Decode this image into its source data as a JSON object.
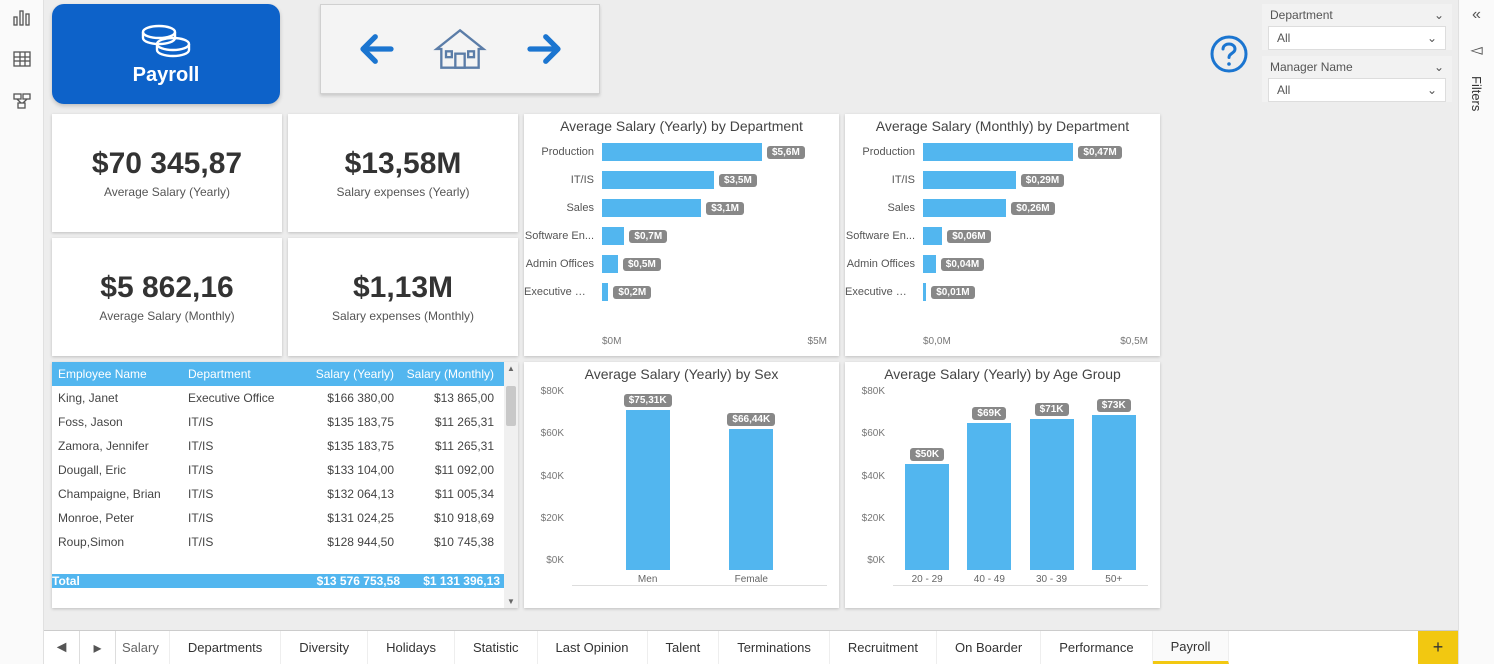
{
  "header": {
    "tile_label": "Payroll"
  },
  "slicers": {
    "department": {
      "label": "Department",
      "value": "All"
    },
    "manager": {
      "label": "Manager Name",
      "value": "All"
    }
  },
  "filters_panel_label": "Filters",
  "kpis": [
    {
      "value": "$70 345,87",
      "label": "Average Salary (Yearly)"
    },
    {
      "value": "$13,58M",
      "label": "Salary expenses (Yearly)"
    },
    {
      "value": "$5 862,16",
      "label": "Average Salary (Monthly)"
    },
    {
      "value": "$1,13M",
      "label": "Salary expenses (Monthly)"
    }
  ],
  "charts": {
    "yearly_dept": {
      "title": "Average Salary (Yearly) by Department",
      "axis_min": "$0M",
      "axis_max": "$5M"
    },
    "monthly_dept": {
      "title": "Average Salary (Monthly) by Department",
      "axis_min": "$0,0M",
      "axis_max": "$0,5M"
    },
    "sex": {
      "title": "Average Salary (Yearly) by Sex"
    },
    "age": {
      "title": "Average Salary (Yearly) by Age Group"
    }
  },
  "table": {
    "headers": {
      "name": "Employee Name",
      "dept": "Department",
      "sy": "Salary (Yearly)",
      "sm": "Salary (Monthly)"
    },
    "rows": [
      {
        "name": "King, Janet",
        "dept": "Executive Office",
        "sy": "$166 380,00",
        "sm": "$13 865,00"
      },
      {
        "name": "Foss, Jason",
        "dept": "IT/IS",
        "sy": "$135 183,75",
        "sm": "$11 265,31"
      },
      {
        "name": "Zamora, Jennifer",
        "dept": "IT/IS",
        "sy": "$135 183,75",
        "sm": "$11 265,31"
      },
      {
        "name": "Dougall, Eric",
        "dept": "IT/IS",
        "sy": "$133 104,00",
        "sm": "$11 092,00"
      },
      {
        "name": "Champaigne, Brian",
        "dept": "IT/IS",
        "sy": "$132 064,13",
        "sm": "$11 005,34"
      },
      {
        "name": "Monroe, Peter",
        "dept": "IT/IS",
        "sy": "$131 024,25",
        "sm": "$10 918,69"
      },
      {
        "name": "Roup,Simon",
        "dept": "IT/IS",
        "sy": "$128 944,50",
        "sm": "$10 745,38"
      }
    ],
    "total": {
      "label": "Total",
      "sy": "$13 576 753,58",
      "sm": "$1 131 396,13"
    }
  },
  "tabs": [
    "Salary",
    "Departments",
    "Diversity",
    "Holidays",
    "Statistic",
    "Last Opinion",
    "Talent",
    "Terminations",
    "Recruitment",
    "On Boarder",
    "Performance",
    "Payroll"
  ],
  "chart_data": [
    {
      "type": "bar",
      "orientation": "horizontal",
      "title": "Average Salary (Yearly) by Department",
      "categories": [
        "Production",
        "IT/IS",
        "Sales",
        "Software En...",
        "Admin Offices",
        "Executive Of..."
      ],
      "values_label": [
        "$5,6M",
        "$3,5M",
        "$3,1M",
        "$0,7M",
        "$0,5M",
        "$0,2M"
      ],
      "values": [
        5.6,
        3.5,
        3.1,
        0.7,
        0.5,
        0.2
      ],
      "xlabel": "",
      "ylabel": "",
      "xlim": [
        0,
        5
      ],
      "unit": "M"
    },
    {
      "type": "bar",
      "orientation": "horizontal",
      "title": "Average Salary (Monthly) by Department",
      "categories": [
        "Production",
        "IT/IS",
        "Sales",
        "Software En...",
        "Admin Offices",
        "Executive Of..."
      ],
      "values_label": [
        "$0,47M",
        "$0,29M",
        "$0,26M",
        "$0,06M",
        "$0,04M",
        "$0,01M"
      ],
      "values": [
        0.47,
        0.29,
        0.26,
        0.06,
        0.04,
        0.01
      ],
      "xlabel": "",
      "ylabel": "",
      "xlim": [
        0,
        0.5
      ],
      "unit": "M"
    },
    {
      "type": "bar",
      "orientation": "vertical",
      "title": "Average Salary (Yearly) by Sex",
      "categories": [
        "Men",
        "Female"
      ],
      "values_label": [
        "$75,31K",
        "$66,44K"
      ],
      "values": [
        75.31,
        66.44
      ],
      "ylim": [
        0,
        80
      ],
      "yticks": [
        "$80K",
        "$60K",
        "$40K",
        "$20K",
        "$0K"
      ],
      "unit": "K"
    },
    {
      "type": "bar",
      "orientation": "vertical",
      "title": "Average Salary (Yearly) by Age Group",
      "categories": [
        "20 - 29",
        "40 - 49",
        "30 - 39",
        "50+"
      ],
      "values_label": [
        "$50K",
        "$69K",
        "$71K",
        "$73K"
      ],
      "values": [
        50,
        69,
        71,
        73
      ],
      "ylim": [
        0,
        80
      ],
      "yticks": [
        "$80K",
        "$60K",
        "$40K",
        "$20K",
        "$0K"
      ],
      "unit": "K"
    }
  ]
}
